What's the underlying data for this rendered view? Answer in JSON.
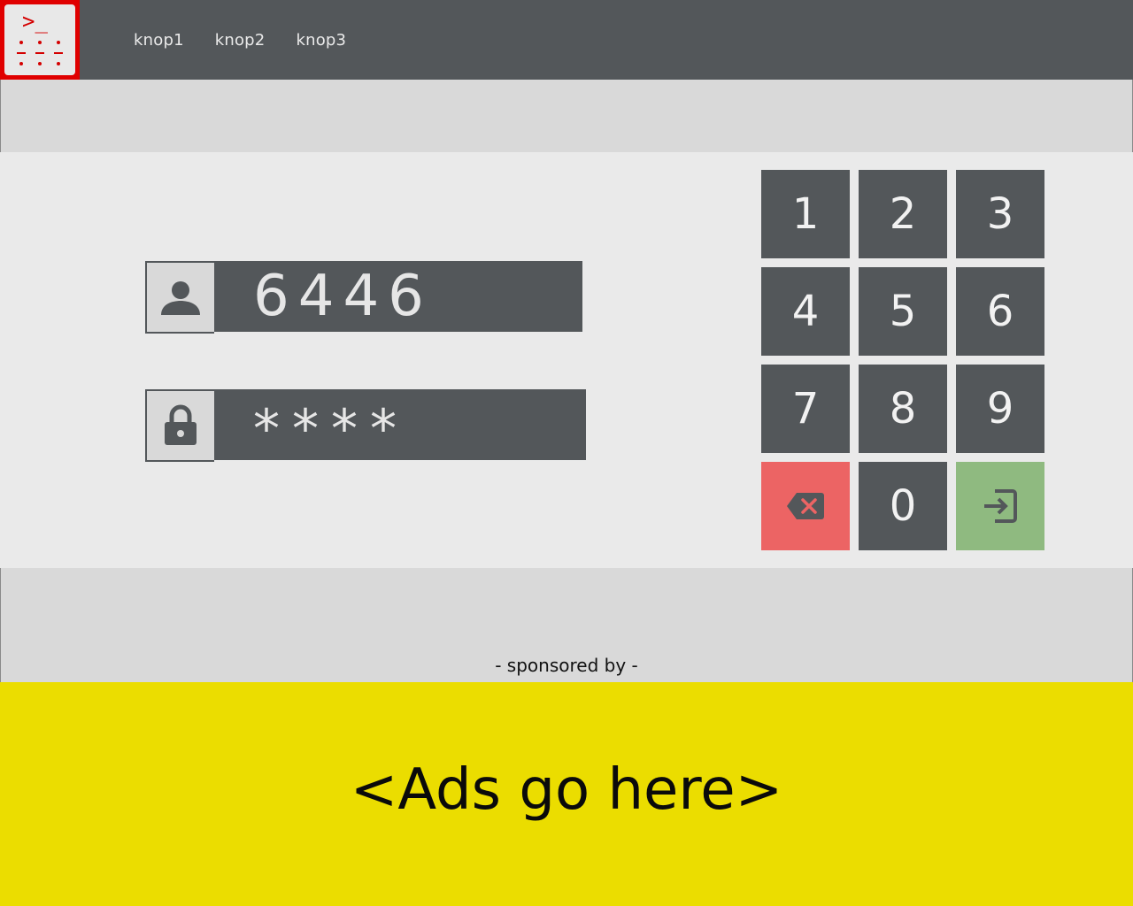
{
  "app": {
    "logo_icon": "terminal-keypad-logo-icon",
    "logo_glyph": ">_"
  },
  "nav": {
    "items": [
      {
        "label": "knop1"
      },
      {
        "label": "knop2"
      },
      {
        "label": "knop3"
      }
    ]
  },
  "login": {
    "user_icon": "user-icon",
    "user_value": "6446",
    "lock_icon": "lock-icon",
    "password_value": "****"
  },
  "keypad": {
    "keys": [
      {
        "label": "1"
      },
      {
        "label": "2"
      },
      {
        "label": "3"
      },
      {
        "label": "4"
      },
      {
        "label": "5"
      },
      {
        "label": "6"
      },
      {
        "label": "7"
      },
      {
        "label": "8"
      },
      {
        "label": "9"
      },
      {
        "label": "",
        "icon": "backspace-icon"
      },
      {
        "label": "0"
      },
      {
        "label": "",
        "icon": "enter-icon"
      }
    ]
  },
  "footer": {
    "sponsored_label": "- sponsored by -",
    "ads_label": "<Ads go here>"
  },
  "colors": {
    "topbar": "#53575a",
    "logo_border": "#e00000",
    "key": "#53575a",
    "delete_key": "#ec6464",
    "enter_key": "#8fba80",
    "ads_background": "#ebdd00"
  }
}
